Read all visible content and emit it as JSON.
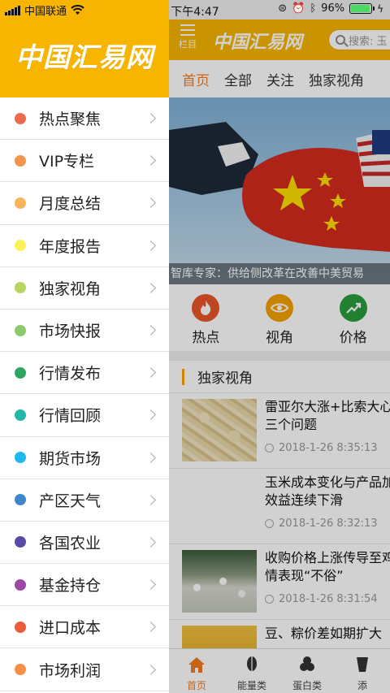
{
  "status_bar": {
    "carrier": "中国联通",
    "time": "下午4:47",
    "battery": "96%",
    "battery_level": 0.96
  },
  "drawer": {
    "logo": "中国汇易网",
    "items": [
      {
        "label": "热点聚焦",
        "color": "#ee6a4f"
      },
      {
        "label": "VIP专栏",
        "color": "#f29350"
      },
      {
        "label": "月度总结",
        "color": "#f7b55b"
      },
      {
        "label": "年度报告",
        "color": "#fbef5b"
      },
      {
        "label": "独家视角",
        "color": "#b6d561"
      },
      {
        "label": "市场快报",
        "color": "#8bc96c"
      },
      {
        "label": "行情发布",
        "color": "#2fa65f"
      },
      {
        "label": "行情回顾",
        "color": "#22b8a8"
      },
      {
        "label": "期货市场",
        "color": "#1fb9ee"
      },
      {
        "label": "产区天气",
        "color": "#3e87c9"
      },
      {
        "label": "各国农业",
        "color": "#5a4aa6"
      },
      {
        "label": "基金持仓",
        "color": "#9b4aa6"
      },
      {
        "label": "进口成本",
        "color": "#ee5c3a"
      },
      {
        "label": "市场利润",
        "color": "#f39047"
      }
    ]
  },
  "main": {
    "menu_label": "栏目",
    "logo": "中国汇易网",
    "search_placeholder": "搜索: 玉",
    "tabs": [
      "首页",
      "全部",
      "关注",
      "独家视角"
    ],
    "banner_caption": "智库专家：供给侧改革在改善中美贸易",
    "categories": [
      {
        "label": "热点",
        "icon": "flame-icon",
        "color": "#e8562a"
      },
      {
        "label": "视角",
        "icon": "eye-icon",
        "color": "#f5a100"
      },
      {
        "label": "价格",
        "icon": "trend-up-icon",
        "color": "#2a9d3c"
      }
    ],
    "section_title": "独家视角",
    "news": [
      {
        "title": "雷亚尔大涨+比索大心这三个问题",
        "time": "2018-1-26 8:35:13"
      },
      {
        "title": "玉米成本变化与产品加工效益连续下滑",
        "time": "2018-1-26 8:32:13"
      },
      {
        "title": "收购价格上涨传导至鸡行情表现“不俗”",
        "time": "2018-1-26 8:31:54"
      },
      {
        "title": "豆、粽价差如期扩大",
        "time": ""
      }
    ],
    "tabbar": [
      {
        "label": "首页",
        "icon": "home-icon"
      },
      {
        "label": "能量类",
        "icon": "grain-icon"
      },
      {
        "label": "蛋白类",
        "icon": "bean-icon"
      },
      {
        "label": "添",
        "icon": "additive-icon"
      }
    ]
  }
}
